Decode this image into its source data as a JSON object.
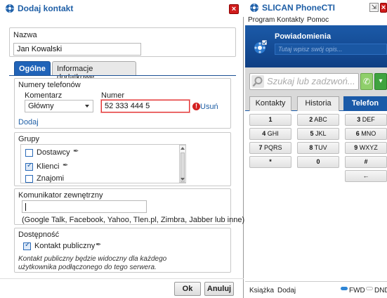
{
  "dialog": {
    "title": "Dodaj kontakt",
    "close_glyph": "×",
    "name": {
      "label": "Nazwa",
      "value": "Jan Kowalski"
    },
    "tabs": [
      {
        "label": "Ogólne",
        "active": true
      },
      {
        "label": "Informacje dodatkowe",
        "active": false
      }
    ],
    "phones": {
      "legend": "Numery telefonów",
      "comment_label": "Komentarz",
      "number_label": "Numer",
      "comment_value": "Główny",
      "number_value": "52 333 444 5",
      "error_glyph": "!",
      "delete_link": "Usuń",
      "add_link": "Dodaj"
    },
    "groups": {
      "legend": "Grupy",
      "items": [
        {
          "label": "Dostawcy",
          "checked": false
        },
        {
          "label": "Klienci",
          "checked": true
        },
        {
          "label": "Znajomi",
          "checked": false
        }
      ]
    },
    "messenger": {
      "legend": "Komunikator zewnętrzny",
      "value": "",
      "hint": "(Google Talk, Facebook, Yahoo, Tlen.pl, Zimbra, Jabber lub inne)"
    },
    "availability": {
      "legend": "Dostępność",
      "public_label": "Kontakt publiczny",
      "public_checked": true,
      "note": "Kontakt publiczny będzie widoczny dla każdego użytkownika podłączonego do tego serwera."
    },
    "buttons": {
      "ok": "Ok",
      "cancel": "Anuluj"
    }
  },
  "cti": {
    "title": "SLICAN PhoneCTI",
    "pin_glyph": "⇲",
    "close_glyph": "×",
    "menu": [
      "Program",
      "Kontakty",
      "Pomoc"
    ],
    "notifications": {
      "title": "Powiadomienia",
      "placeholder": "Tutaj wpisz swój opis..."
    },
    "search_placeholder": "Szukaj lub zadzwoń...",
    "call_glyph": "✆",
    "more_glyph": "▾",
    "tabs": [
      {
        "label": "Kontakty",
        "active": false
      },
      {
        "label": "Historia",
        "active": false
      },
      {
        "label": "Telefon",
        "active": true
      }
    ],
    "keys": [
      {
        "digit": "1",
        "letters": ""
      },
      {
        "digit": "2",
        "letters": "ABC"
      },
      {
        "digit": "3",
        "letters": "DEF"
      },
      {
        "digit": "4",
        "letters": "GHI"
      },
      {
        "digit": "5",
        "letters": "JKL"
      },
      {
        "digit": "6",
        "letters": "MNO"
      },
      {
        "digit": "7",
        "letters": "PQRS"
      },
      {
        "digit": "8",
        "letters": "TUV"
      },
      {
        "digit": "9",
        "letters": "WXYZ"
      },
      {
        "digit": "*",
        "letters": ""
      },
      {
        "digit": "0",
        "letters": ""
      },
      {
        "digit": "#",
        "letters": ""
      }
    ],
    "backspace_glyph": "←",
    "status": {
      "book": "Książka",
      "add": "Dodaj",
      "fwd": "FWD",
      "dnd": "DND"
    }
  },
  "colors": {
    "accent": "#1f5fa6",
    "close": "#d11c1c",
    "error": "#d32020",
    "fwd_on": "#2f86d6",
    "dnd_off": "#c8c8c8"
  }
}
